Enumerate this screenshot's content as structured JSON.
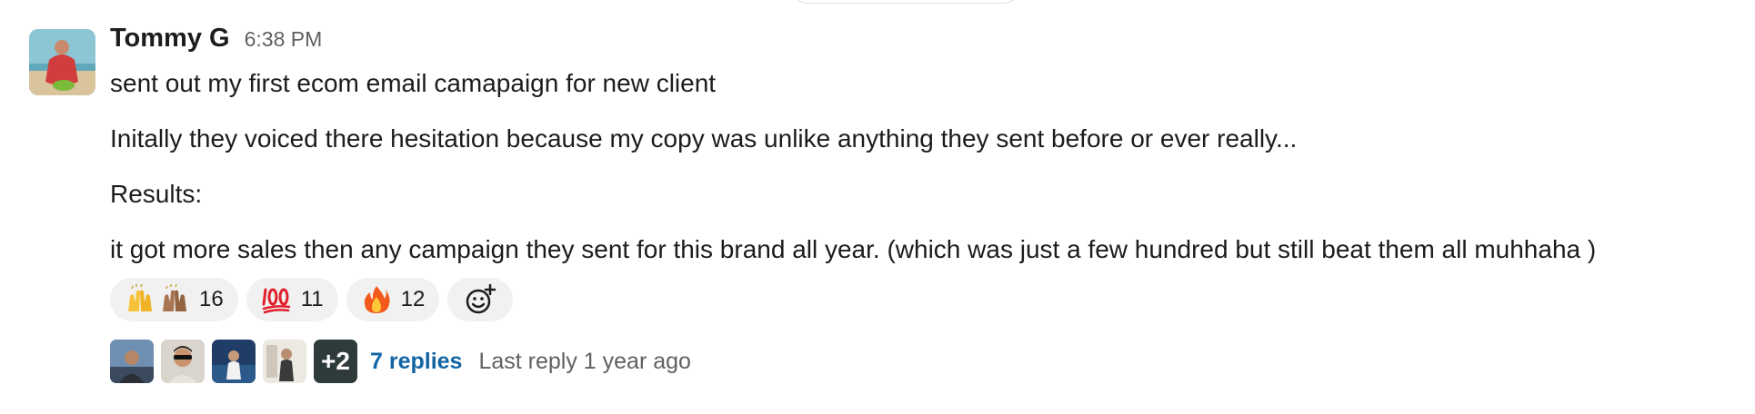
{
  "message": {
    "sender": "Tommy G",
    "time": "6:38 PM",
    "lines": [
      "sent out my first ecom email camapaign for new client",
      "Initally they voiced there hesitation because my copy was unlike anything they sent before or ever really...",
      "Results:",
      "it got more sales then any campaign they sent for this brand all year. (which was just a few hundred but still beat them all muhhaha )"
    ],
    "reactions": [
      {
        "emoji_names": [
          "raised-hands-icon",
          "raised-hands-medium-skin-icon"
        ],
        "count": "16"
      },
      {
        "emoji_names": [
          "hundred-points-icon"
        ],
        "count": "11"
      },
      {
        "emoji_names": [
          "fire-icon"
        ],
        "count": "12"
      }
    ],
    "add_reaction_icon": "add-reaction-icon",
    "thread": {
      "extra_repliers": "+2",
      "replies": "7 replies",
      "last_reply": "Last reply 1 year ago"
    }
  },
  "colors": {
    "link": "#1264a3",
    "muted": "#616061",
    "reaction_bg": "#f1f1f1",
    "text": "#1d1c1d"
  }
}
